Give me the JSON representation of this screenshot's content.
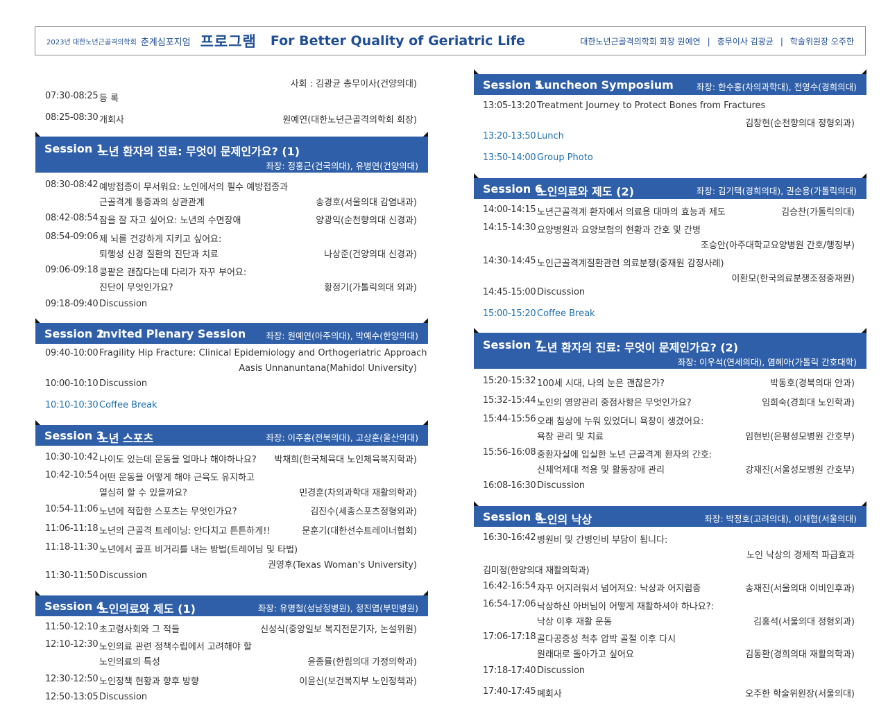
{
  "header": {
    "year_society": "2023년 대한노년근골격의학회",
    "event": "춘계심포지엄",
    "program": "프로그램",
    "tagline": "For Better Quality of Geriatric Life",
    "officers": [
      "대한노년근골격의학회 회장  원예연",
      "총무이사  김광균",
      "학술위원장  오주한"
    ],
    "separator": "|"
  },
  "moderator": "사회 : 김광균 총무이사(건양의대)",
  "left": {
    "opening": [
      {
        "time": "07:30-08:25",
        "title": "등   록",
        "speaker": ""
      },
      {
        "time": "08:25-08:30",
        "title": "개회사",
        "speaker": "원예연(대한노년근골격의학회 회장)"
      }
    ],
    "s1": {
      "name": "Session 1",
      "title": "노년 환자의 진료: 무엇이 문제인가요? (1)",
      "chair": "좌장: 정홍근(건국의대), 유병연(건양의대)",
      "items": [
        {
          "time": "08:30-08:42",
          "title": "예방접종이 무서워요: 노인에서의 필수 예방접종과",
          "title2": "근골격계 통증과의 상관관계",
          "speaker": "송경호(서울의대 감염내과)"
        },
        {
          "time": "08:42-08:54",
          "title": "잠을 잘 자고 싶어요: 노년의 수면장애",
          "speaker": "양광익(순천향의대 신경과)"
        },
        {
          "time": "08:54-09:06",
          "title": "제 뇌를 건강하게 지키고 싶어요:",
          "title2": "퇴행성 신경 질환의 진단과 치료",
          "speaker": "나상준(건양의대 신경과)"
        },
        {
          "time": "09:06-09:18",
          "title": "콩팥은 괜찮다는데 다리가 자꾸 부어요:",
          "title2": "진단이 무엇인가요?",
          "speaker": "황정기(가톨릭의대 외과)"
        },
        {
          "time": "09:18-09:40",
          "title": "Discussion",
          "speaker": ""
        }
      ]
    },
    "s2": {
      "name": "Session 2",
      "title": "Invited Plenary Session",
      "chair": "좌장: 원예연(아주의대), 박예수(한양의대)",
      "items": [
        {
          "time": "09:40-10:00",
          "title": "Fragility Hip Fracture: Clinical Epidemiology and Orthogeriatric Approach",
          "speaker2": "Aasis Unnanuntana(Mahidol University)"
        },
        {
          "time": "10:00-10:10",
          "title": "Discussion"
        },
        {
          "time": "10:10-10:30",
          "title": "Coffee Break"
        }
      ]
    },
    "s3": {
      "name": "Session 3",
      "title": "노년 스포츠",
      "chair": "좌장: 이주홍(전북의대), 고상훈(울산의대)",
      "items": [
        {
          "time": "10:30-10:42",
          "title": "나이도 있는데 운동을 얼마나 해야하나요?",
          "speaker": "박채희(한국체육대 노인체육복지학과)"
        },
        {
          "time": "10:42-10:54",
          "title": "어떤 운동을 어떻게 해야 근육도 유지하고",
          "title2": "열심히 할 수 있을까요?",
          "speaker": "민경훈(차의과학대 재활의학과)"
        },
        {
          "time": "10:54-11:06",
          "title": "노년에 적합한 스포츠는 무엇인가요?",
          "speaker": "김진수(세종스포츠정형외과)"
        },
        {
          "time": "11:06-11:18",
          "title": "노년의 근골격 트레이닝: 안다치고 튼튼하게!!",
          "speaker": "문훈기(대한선수트레이너협회)"
        },
        {
          "time": "11:18-11:30",
          "title": "노년에서 골프 비거리를 내는 방법(트레이닝 및 타법)",
          "speaker2": "권영후(Texas Woman's University)"
        },
        {
          "time": "11:30-11:50",
          "title": "Discussion"
        }
      ]
    },
    "s4": {
      "name": "Session 4",
      "title": "노인의료와 제도 (1)",
      "chair": "좌장: 유명철(성남정병원), 정진엽(부민병원)",
      "items": [
        {
          "time": "11:50-12:10",
          "title": "초고령사회와 그 적들",
          "speaker": "신성식(중앙일보 복지전문기자, 논설위원)"
        },
        {
          "time": "12:10-12:30",
          "title": "노인의료 관련 정책수립에서 고려해야 할",
          "title2": "노인의료의 특성",
          "speaker": "윤종률(한림의대 가정의학과)"
        },
        {
          "time": "12:30-12:50",
          "title": "노인정책 현황과 향후 방향",
          "speaker": "이윤신(보건복지부 노인정책과)"
        },
        {
          "time": "12:50-13:05",
          "title": "Discussion"
        }
      ]
    }
  },
  "right": {
    "s5": {
      "name": "Session 5",
      "title": "Luncheon Symposium",
      "chair": "좌장: 한수홍(차의과학대), 전영수(경희의대)",
      "items": [
        {
          "time": "13:05-13:20",
          "title": "Treatment Journey to Protect Bones from Fractures",
          "speaker2": "김창현(순천향의대 정형외과)"
        },
        {
          "time": "13:20-13:50",
          "title": "Lunch"
        },
        {
          "time": "13:50-14:00",
          "title": "Group Photo"
        }
      ]
    },
    "s6": {
      "name": "Session 6",
      "title": "노인의료와 제도 (2)",
      "chair": "좌장: 김기택(경희의대), 권순용(가톨릭의대)",
      "items": [
        {
          "time": "14:00-14:15",
          "title": "노년근골격계 환자에서 의료용 대마의 효능과 제도",
          "speaker": "김승찬(가톨릭의대)"
        },
        {
          "time": "14:15-14:30",
          "title": "요양병원과 요양보험의 현황과 간호 및 간병",
          "speaker2": "조승안(아주대학교요양병원 간호/행정부)"
        },
        {
          "time": "14:30-14:45",
          "title": "노인근골격계질환관련 의료분쟁(중재원 감정사례)",
          "speaker2": "이환모(한국의료분쟁조정중재원)"
        },
        {
          "time": "14:45-15:00",
          "title": "Discussion"
        },
        {
          "time": "15:00-15:20",
          "title": "Coffee Break"
        }
      ]
    },
    "s7": {
      "name": "Session 7",
      "title": "노년 환자의 진료: 무엇이 문제인가요? (2)",
      "chair": "좌장: 이우석(연세의대), 염혜아(가톨릭 간호대학)",
      "items": [
        {
          "time": "15:20-15:32",
          "title": "100세 시대, 나의 눈은 괜찮은가?",
          "speaker": "박동호(경북의대 안과)"
        },
        {
          "time": "15:32-15:44",
          "title": "노인의 영양관리 중점사항은 무엇인가요?",
          "speaker": "임희숙(경희대 노인학과)"
        },
        {
          "time": "15:44-15:56",
          "title": "오래 침상에 누워 있었더니 욕창이 생겼어요:",
          "title2": "욕창 관리 및 치료",
          "speaker": "임현빈(은평성모병원 간호부)"
        },
        {
          "time": "15:56-16:08",
          "title": "중환자실에 입실한 노년 근골격계 환자의 간호:",
          "title2": "신체억제대 적용 및 활동장애 관리",
          "speaker": "강재진(서울성모병원 간호부)"
        },
        {
          "time": "16:08-16:30",
          "title": "Discussion"
        }
      ]
    },
    "s8": {
      "name": "Session 8",
      "title": "노인의 낙상",
      "chair": "좌장: 박정호(고려의대), 이재협(서울의대)",
      "items": [
        {
          "time": "16:30-16:42",
          "title": "병원비 및 간병인비 부담이 됩니다:",
          "title2": "노인 낙상의 경제적 파급효과",
          "speaker3": "김미정(한양의대 재활의학과)"
        },
        {
          "time": "16:42-16:54",
          "title": "자꾸 어지러워서 넘어져요: 낙상과 어지럼증",
          "speaker": "송재진(서울의대 이비인후과)"
        },
        {
          "time": "16:54-17:06",
          "title": "낙상하신 아버님이 어떻게 재활하셔야 하나요?:",
          "title2": "낙상 이후 재활 운동",
          "speaker": "김홍석(서울의대 정형외과)"
        },
        {
          "time": "17:06-17:18",
          "title": "골다공증성 척추 압박 골절 이후 다시",
          "title2": "원래대로 돌아가고 싶어요",
          "speaker": "김동환(경희의대 재활의학과)"
        },
        {
          "time": "17:18-17:40",
          "title": "Discussion"
        },
        {
          "time": "17:40-17:45",
          "title": "폐회사",
          "speaker": "오주한 학술위원장(서울의대)"
        }
      ]
    }
  }
}
